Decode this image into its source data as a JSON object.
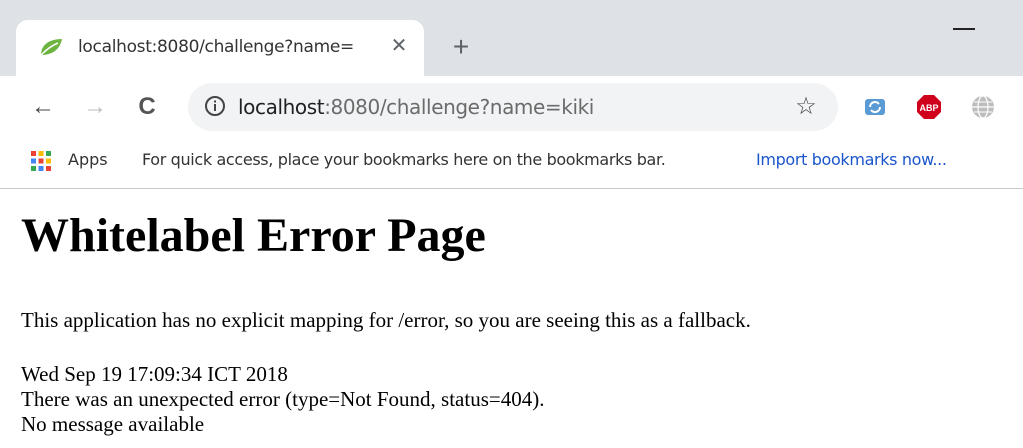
{
  "browser": {
    "tab": {
      "title": "localhost:8080/challenge?name=",
      "close_glyph": "✕",
      "favicon": "spring-leaf-icon"
    },
    "new_tab_glyph": "+",
    "minimize_glyph": "—",
    "nav": {
      "back_glyph": "←",
      "forward_glyph": "→",
      "reload_glyph": "C"
    },
    "omnibox": {
      "host": "localhost",
      "rest": ":8080/challenge?name=kiki",
      "star_glyph": "☆"
    },
    "extensions": [
      "sync-icon",
      "abp-icon",
      "globe-icon"
    ],
    "abp_label": "ABP"
  },
  "bookmarks_bar": {
    "apps_label": "Apps",
    "hint": "For quick access, place your bookmarks here on the bookmarks bar.",
    "import_link": "Import bookmarks now..."
  },
  "page": {
    "title": "Whitelabel Error Page",
    "mapping_message": "This application has no explicit mapping for /error, so you are seeing this as a fallback.",
    "timestamp": "Wed Sep 19 17:09:34 ICT 2018",
    "error_line": "There was an unexpected error (type=Not Found, status=404).",
    "message": "No message available"
  },
  "colors": {
    "tabstrip": "#dee1e6",
    "omnibox": "#f1f3f4",
    "link": "#1a55cc",
    "abp": "#d0021b"
  }
}
